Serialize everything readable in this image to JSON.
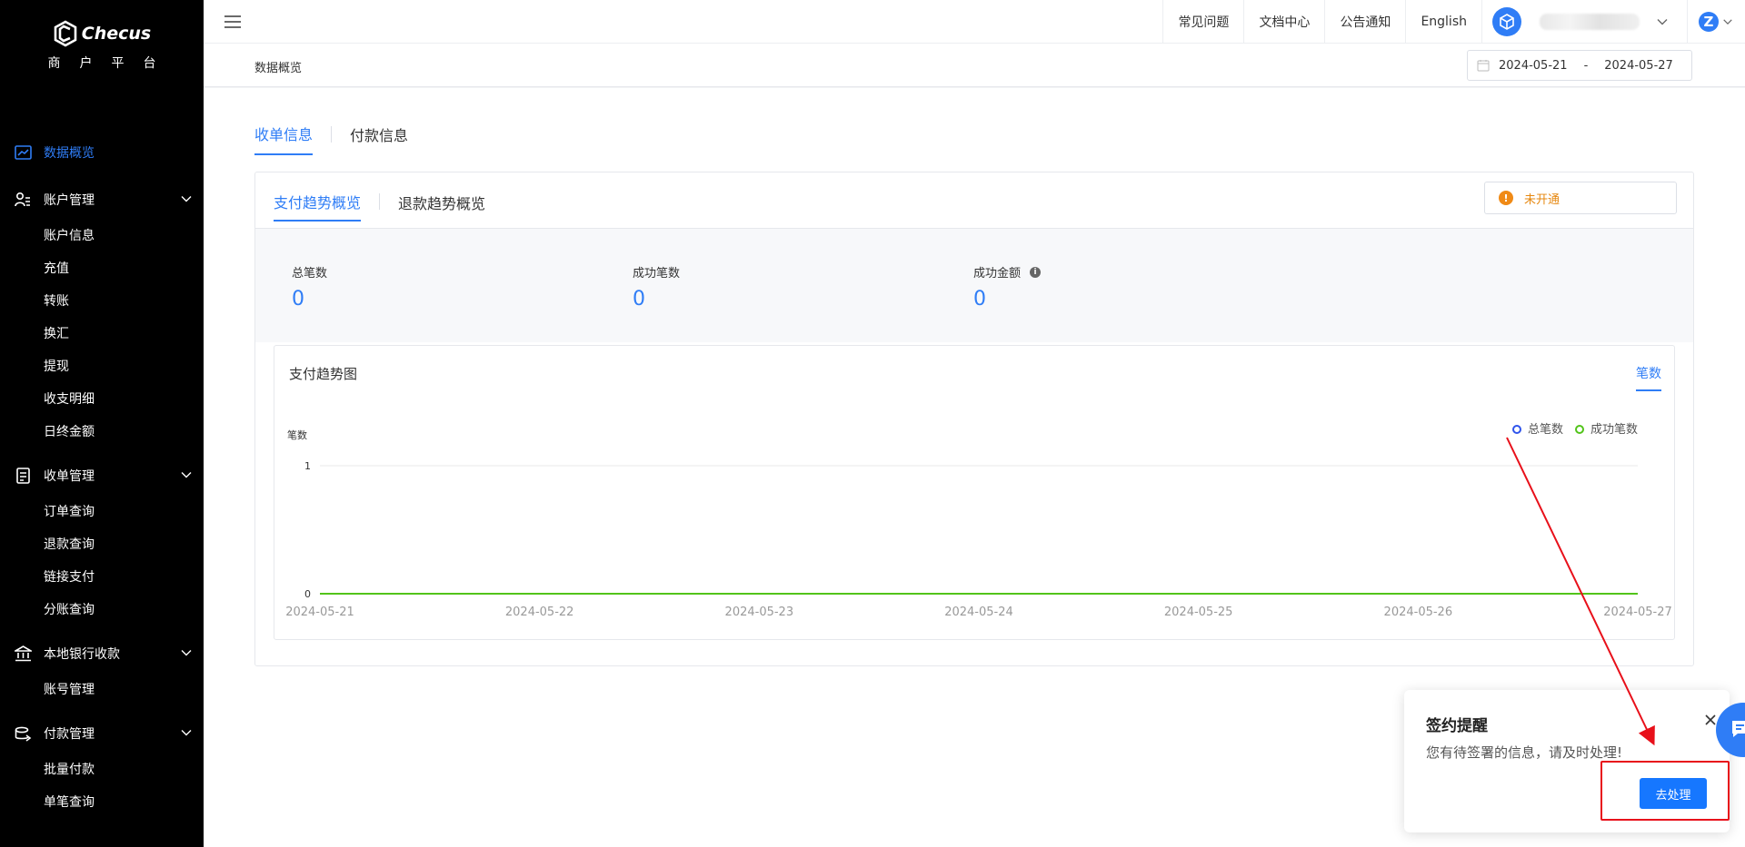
{
  "brand": {
    "name": "Checus",
    "subtitle": "商户平台"
  },
  "sidebar": {
    "items": [
      {
        "label": "数据概览",
        "icon": "chart-line-icon",
        "active": true
      },
      {
        "label": "账户管理",
        "icon": "user-manage-icon",
        "children": [
          "账户信息",
          "充值",
          "转账",
          "换汇",
          "提现",
          "收支明细",
          "日终金额"
        ]
      },
      {
        "label": "收单管理",
        "icon": "receipt-icon",
        "children": [
          "订单查询",
          "退款查询",
          "链接支付",
          "分账查询"
        ]
      },
      {
        "label": "本地银行收款",
        "icon": "bank-icon",
        "children": [
          "账号管理"
        ]
      },
      {
        "label": "付款管理",
        "icon": "payout-icon",
        "children": [
          "批量付款",
          "单笔查询"
        ]
      }
    ]
  },
  "topbar": {
    "links": [
      "常见问题",
      "文档中心",
      "公告通知",
      "English"
    ],
    "user_initial": "Z"
  },
  "breadcrumb": "数据概览",
  "date_range": {
    "start": "2024-05-21",
    "separator": "-",
    "end": "2024-05-27"
  },
  "main_tabs": [
    "收单信息",
    "付款信息"
  ],
  "sub_tabs": [
    "支付趋势概览",
    "退款趋势概览"
  ],
  "status": {
    "label": "未开通",
    "color": "#e6870f"
  },
  "stats": [
    {
      "label": "总笔数",
      "value": "0"
    },
    {
      "label": "成功笔数",
      "value": "0"
    },
    {
      "label": "成功金额",
      "value": "0",
      "info": true
    }
  ],
  "chart_header": {
    "title": "支付趋势图",
    "unit_tab": "笔数"
  },
  "chart_data": {
    "type": "line",
    "title": "支付趋势图",
    "ylabel": "笔数",
    "x": [
      "2024-05-21",
      "2024-05-22",
      "2024-05-23",
      "2024-05-24",
      "2024-05-25",
      "2024-05-26",
      "2024-05-27"
    ],
    "series": [
      {
        "name": "总笔数",
        "color": "#2f54eb",
        "values": [
          0,
          0,
          0,
          0,
          0,
          0,
          0
        ]
      },
      {
        "name": "成功笔数",
        "color": "#52c41a",
        "values": [
          0,
          0,
          0,
          0,
          0,
          0,
          0
        ]
      }
    ],
    "ylim": [
      0,
      1
    ],
    "yticks": [
      "1",
      "0"
    ],
    "legend": "top-right",
    "grid": true
  },
  "popup": {
    "title": "签约提醒",
    "message": "您有待签署的信息，请及时处理!",
    "button": "去处理"
  },
  "colors": {
    "accent": "#2f7df6",
    "annotation": "#e8101a"
  }
}
